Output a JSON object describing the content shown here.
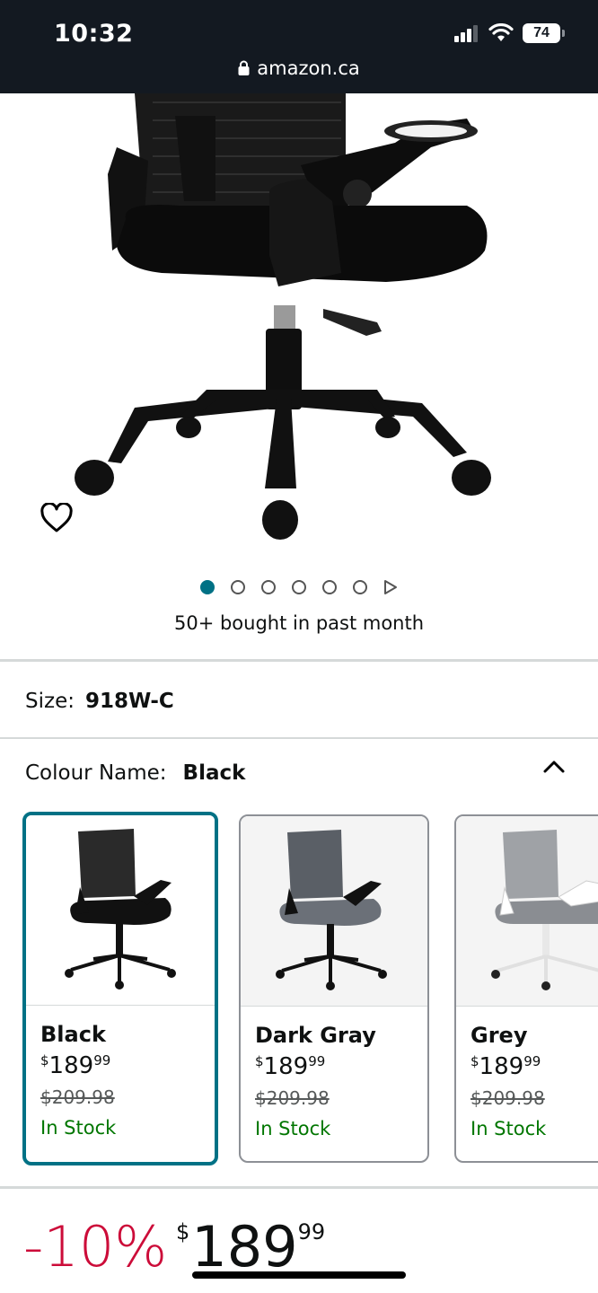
{
  "status_bar": {
    "time": "10:32",
    "battery": "74",
    "url": "amazon.ca"
  },
  "product": {
    "bought_text": "50+ bought in past month",
    "image_count": 6
  },
  "size": {
    "label": "Size:",
    "value": "918W-C"
  },
  "colour": {
    "label": "Colour Name:",
    "value": "Black"
  },
  "swatches": [
    {
      "name": "Black",
      "currency": "$",
      "price_whole": "189",
      "price_cents": "99",
      "old_price": "$209.98",
      "stock": "In Stock"
    },
    {
      "name": "Dark Gray",
      "currency": "$",
      "price_whole": "189",
      "price_cents": "99",
      "old_price": "$209.98",
      "stock": "In Stock"
    },
    {
      "name": "Grey",
      "currency": "$",
      "price_whole": "189",
      "price_cents": "99",
      "old_price": "$209.98",
      "stock": "In Stock"
    }
  ],
  "price": {
    "discount": "-10%",
    "currency": "$",
    "whole": "189",
    "cents": "99"
  },
  "colors": {
    "accent": "#007185",
    "status_bg": "#131921",
    "discount": "#cc0c39",
    "stock": "#007600"
  }
}
